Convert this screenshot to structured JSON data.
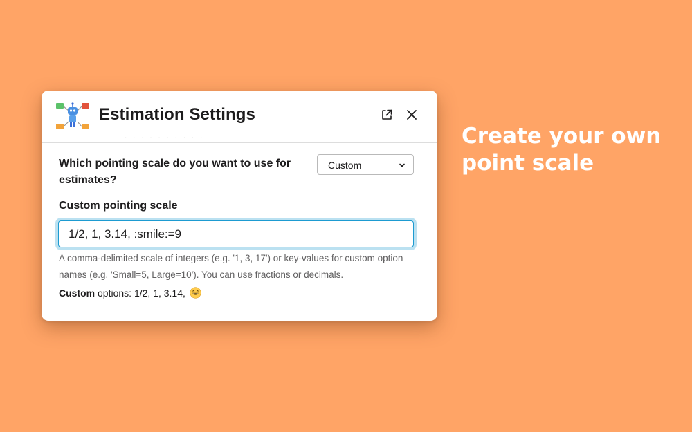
{
  "modal": {
    "title": "Estimation Settings",
    "app_icon": "estimation-bot-icon",
    "open_icon": "open-external-icon",
    "close_icon": "close-icon"
  },
  "scale_question": {
    "label": "Which pointing scale do you want to use for estimates?",
    "selected": "Custom"
  },
  "custom_scale": {
    "label": "Custom pointing scale",
    "value": "1/2, 1, 3.14, :smile:=9",
    "hint": "A comma-delimited scale of integers (e.g. '1, 3, 17') or key-values for custom option names (e.g. 'Small=5, Large=10'). You can use fractions or decimals.",
    "options_prefix": "Custom",
    "options_text": " options: 1/2, 1, 3.14, ",
    "options_emoji": "smile-emoji-icon"
  },
  "promo": {
    "line1": "Create your own",
    "line2": "point scale"
  },
  "colors": {
    "background": "#FFA466",
    "focus": "#1D9BD1"
  }
}
